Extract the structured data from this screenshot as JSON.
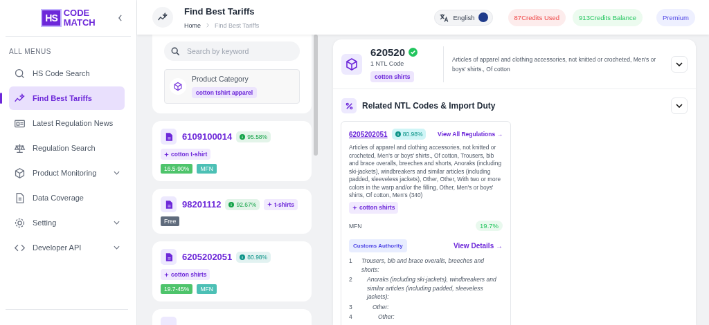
{
  "sidebar": {
    "logo": {
      "mark": "HS",
      "line_1": "CODE",
      "line_2": "MATCH"
    },
    "menu_heading": "ALL MENUS",
    "items": [
      {
        "label": "HS Code Search",
        "selected": false,
        "expandable": false
      },
      {
        "label": "Find Best Tariffs",
        "selected": true,
        "expandable": false
      },
      {
        "label": "Latest Regulation News",
        "selected": false,
        "expandable": false
      },
      {
        "label": "Regulation Search",
        "selected": false,
        "expandable": false
      },
      {
        "label": "Product Monitoring",
        "selected": false,
        "expandable": true
      },
      {
        "label": "Data Coverage",
        "selected": false,
        "expandable": false
      },
      {
        "label": "Setting",
        "selected": false,
        "expandable": true
      },
      {
        "label": "Developer API",
        "selected": false,
        "expandable": true
      }
    ]
  },
  "header": {
    "title": "Find Best Tariffs",
    "breadcrumb": [
      "Home",
      "Find Best Tariffs"
    ],
    "language": "English",
    "credits_used": "87Credits Used",
    "credits_balance": "913Credits Balance",
    "plan": "Premium"
  },
  "search": {
    "placeholder": "Search by keyword"
  },
  "product_category": {
    "label": "Product Category",
    "tag": "cotton tshirt apparel"
  },
  "results": [
    {
      "code": "6109100014",
      "score": "95.58%",
      "color": "#16a34a",
      "keyword": "cotton t-shirt",
      "tags": [
        {
          "text": "16.5-90%",
          "kind": "rate"
        },
        {
          "text": "MFN",
          "kind": "mfn"
        }
      ]
    },
    {
      "code": "98201112",
      "score": "92.67%",
      "color": "#16a34a",
      "keyword": "t-shirts",
      "tags": [
        {
          "text": "Free",
          "kind": "free"
        }
      ]
    },
    {
      "code": "6205202051",
      "score": "80.98%",
      "color": "#0d9488",
      "keyword": "cotton shirts",
      "tags": [
        {
          "text": "19.7-45%",
          "kind": "rate"
        },
        {
          "text": "MFN",
          "kind": "mfn"
        }
      ]
    }
  ],
  "hs_detail": {
    "code": "620520",
    "verified": true,
    "ntl_count": "1 NTL Code",
    "tag": "cotton shirts",
    "description": "Articles of apparel and clothing accessories, not knitted or crocheted, Men's or boys' shirts., Of cotton",
    "expanded": false
  },
  "related": {
    "title": "Related NTL Codes & Import Duty",
    "expanded": false,
    "ntl": {
      "code": "6205202051",
      "score": "80.98%",
      "link": "View All Regulations →",
      "description": "Articles of apparel and clothing accessories, not knitted or crocheted, Men's or boys' shirts., Of cotton, Trousers, bib and brace overalls, breeches and shorts, Anoraks (including ski-jackets), windbreakers and similar articles (including padded, sleeveless jackets), Other, Other, With two or more colors in the warp and/or the filling, Other, Men's or boys' shirts, Of cotton, Men's (340)",
      "keyword": "cotton shirts",
      "duty_label": "MFN",
      "duty_rate": "19.7%",
      "authority": "Customs Authority",
      "details_link": "View Details →",
      "hierarchy": [
        {
          "number": "1",
          "text": "Trousers, bib and brace overalls, breeches and shorts:",
          "children": [
            {
              "number": "2",
              "text": "Anoraks (including ski-jackets), windbreakers and similar articles (including padded, sleeveless jackets):",
              "children": [
                {
                  "number": "3",
                  "text": "Other:",
                  "children": [
                    {
                      "number": "4",
                      "text": "Other:"
                    }
                  ]
                }
              ]
            }
          ]
        }
      ]
    }
  }
}
